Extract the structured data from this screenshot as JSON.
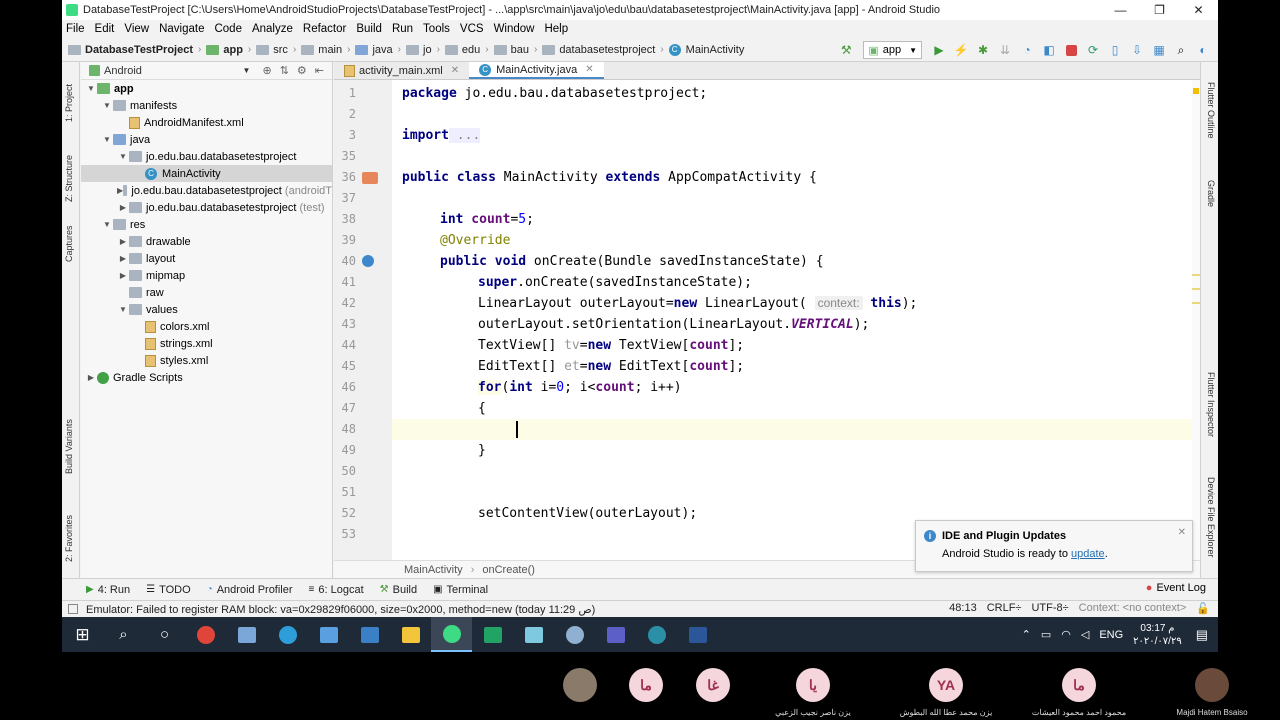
{
  "window": {
    "title": "DatabaseTestProject [C:\\Users\\Home\\AndroidStudioProjects\\DatabaseTestProject] - ...\\app\\src\\main\\java\\jo\\edu\\bau\\databasetestproject\\MainActivity.java [app] - Android Studio",
    "minimize": "—",
    "maximize": "❐",
    "close": "✕"
  },
  "menu": [
    "File",
    "Edit",
    "View",
    "Navigate",
    "Code",
    "Analyze",
    "Refactor",
    "Build",
    "Run",
    "Tools",
    "VCS",
    "Window",
    "Help"
  ],
  "breadcrumb": [
    "DatabaseTestProject",
    "app",
    "src",
    "main",
    "java",
    "jo",
    "edu",
    "bau",
    "databasetestproject",
    "MainActivity"
  ],
  "toolbar": {
    "run_config": "app"
  },
  "left_strip": {
    "project": "1: Project",
    "structure": "Z: Structure",
    "captures": "Captures",
    "build_variants": "Build Variants",
    "favorites": "2: Favorites"
  },
  "right_strip": {
    "flutter_outline": "Flutter Outline",
    "gradle": "Gradle",
    "flutter_inspector": "Flutter Inspector",
    "device_file_explorer": "Device File Explorer"
  },
  "project": {
    "view": "Android",
    "tree": [
      {
        "label": "app",
        "extra": ""
      },
      {
        "label": "manifests",
        "extra": ""
      },
      {
        "label": "AndroidManifest.xml",
        "extra": ""
      },
      {
        "label": "java",
        "extra": ""
      },
      {
        "label": "jo.edu.bau.databasetestproject",
        "extra": ""
      },
      {
        "label": "MainActivity",
        "extra": ""
      },
      {
        "label": "jo.edu.bau.databasetestproject",
        "extra": "(androidT"
      },
      {
        "label": "jo.edu.bau.databasetestproject",
        "extra": "(test)"
      },
      {
        "label": "res",
        "extra": ""
      },
      {
        "label": "drawable",
        "extra": ""
      },
      {
        "label": "layout",
        "extra": ""
      },
      {
        "label": "mipmap",
        "extra": ""
      },
      {
        "label": "raw",
        "extra": ""
      },
      {
        "label": "values",
        "extra": ""
      },
      {
        "label": "colors.xml",
        "extra": ""
      },
      {
        "label": "strings.xml",
        "extra": ""
      },
      {
        "label": "styles.xml",
        "extra": ""
      },
      {
        "label": "Gradle Scripts",
        "extra": ""
      }
    ]
  },
  "tabs": [
    "activity_main.xml",
    "MainActivity.java"
  ],
  "code": {
    "line_numbers": [
      "1",
      "2",
      "3",
      "35",
      "36",
      "37",
      "38",
      "39",
      "40",
      "41",
      "42",
      "43",
      "44",
      "45",
      "46",
      "47",
      "48",
      "49",
      "50",
      "51",
      "52",
      "53"
    ],
    "package_kw": "package",
    "package_name": " jo.edu.bau.databasetestproject;",
    "import_kw": "import",
    "import_fold": " ...",
    "public": "public",
    "class": " class",
    "class_name": " MainActivity ",
    "extends": "extends",
    "superclass": " AppCompatActivity {",
    "int": "int",
    "count_field": " count",
    "count_value": "5",
    "override": "@Override",
    "void": " void",
    "method": " onCreate(Bundle savedInstanceState) {",
    "super": "super",
    "super_call": ".onCreate(savedInstanceState);",
    "ll_decl": "LinearLayout outerLayout=",
    "new": "new",
    "ll_ctor": " LinearLayout(",
    "param_hint": "context:",
    "this": "this",
    "ll_end": ");",
    "orient": "outerLayout.setOrientation(LinearLayout.",
    "vertical": "VERTICAL",
    "orient_end": ");",
    "tv_type": "TextView[] ",
    "tv_var": "tv",
    "tv_new": " TextView[",
    "count_ref": "count",
    "arr_end": "];",
    "et_type": "EditText[] ",
    "et_var": "et",
    "et_new": " EditText[",
    "for": "for",
    "for_open": "(",
    "for_int": "int",
    "for_init": " i=",
    "zero": "0",
    "for_cond": "; i<",
    "for_inc": "; i++)",
    "brace_open": "{",
    "brace_close": "}",
    "set_content": "setContentView(outerLayout);"
  },
  "editor_breadcrumb": [
    "MainActivity",
    "onCreate()"
  ],
  "notification": {
    "title": "IDE and Plugin Updates",
    "body": "Android Studio is ready to ",
    "link": "update",
    "end": "."
  },
  "tool_windows": [
    {
      "icon": "▶",
      "label": "4: Run"
    },
    {
      "icon": "☰",
      "label": "TODO"
    },
    {
      "icon": "◔",
      "label": "Android Profiler"
    },
    {
      "icon": "≡",
      "label": "6: Logcat"
    },
    {
      "icon": "⚒",
      "label": "Build"
    },
    {
      "icon": "▣",
      "label": "Terminal"
    }
  ],
  "event_log": "Event Log",
  "status": {
    "message": "Emulator: Failed to register RAM block: va=0x29829f06000, size=0x2000, method=new (today 11:29 ص)",
    "position": "48:13",
    "line_sep": "CRLF÷",
    "encoding": "UTF-8÷",
    "context": "Context: <no context>"
  },
  "taskbar": {
    "lang": "ENG",
    "time": "03:17 م",
    "date": "٢٠٢٠/٠٧/٢٩"
  },
  "participants": [
    {
      "initials": "",
      "name": ""
    },
    {
      "initials": "ما",
      "name": ""
    },
    {
      "initials": "غا",
      "name": ""
    },
    {
      "initials": "يا",
      "name": "يزن ناصر نجيب الزعبي"
    },
    {
      "initials": "YA",
      "name": "يزن محمد عطا الله البطوش"
    },
    {
      "initials": "ما",
      "name": "محمود احمد محمود العيشات"
    },
    {
      "initials": "",
      "name": "Majdi Hatem Bsaiso"
    }
  ]
}
